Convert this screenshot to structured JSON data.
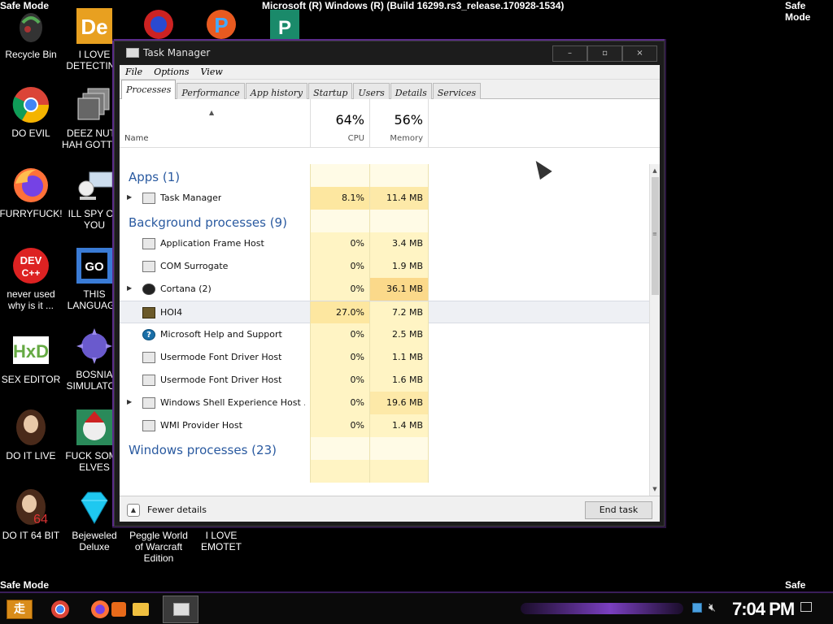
{
  "desktop": {
    "safe_mode_label": "Safe Mode",
    "build_string": "Microsoft (R) Windows (R) (Build 16299.rs3_release.170928-1534)",
    "icons": [
      {
        "label": "Recycle Bin",
        "icon": "recycle-bin-icon"
      },
      {
        "label": "I LOVE DETECTING",
        "icon": "de-app-icon"
      },
      {
        "label": "",
        "icon": "red-blue-app-icon"
      },
      {
        "label": "",
        "icon": "pinball-p-icon"
      },
      {
        "label": "",
        "icon": "publisher-icon"
      },
      {
        "label": "DO EVIL",
        "icon": "chrome-icon"
      },
      {
        "label": "DEEZ NUTS HAH GOTTEM",
        "icon": "copy-windows-icon"
      },
      {
        "label": "FURRYFUCK!",
        "icon": "firefox-icon"
      },
      {
        "label": "ILL SPY ON YOU",
        "icon": "remote-desktop-icon"
      },
      {
        "label": "never used why is it ...",
        "icon": "dev-cpp-icon"
      },
      {
        "label": "THIS LANGUAGE",
        "icon": "goland-icon"
      },
      {
        "label": "SEX EDITOR",
        "icon": "hxd-icon"
      },
      {
        "label": "BOSNIA SIMULATOR",
        "icon": "spiked-ball-icon"
      },
      {
        "label": "DO IT LIVE",
        "icon": "portrait-icon"
      },
      {
        "label": "FUCK SOME ELVES",
        "icon": "santa-game-icon"
      },
      {
        "label": "DO IT 64 BIT",
        "icon": "portrait-64-icon"
      },
      {
        "label": "Bejeweled Deluxe",
        "icon": "bejeweled-gem-icon"
      },
      {
        "label": "Peggle World of Warcraft Edition",
        "icon": ""
      },
      {
        "label": "I LOVE EMOTET",
        "icon": ""
      }
    ]
  },
  "task_manager": {
    "title": "Task Manager",
    "window_controls": [
      "–",
      "▫",
      "×"
    ],
    "menu": [
      "File",
      "Options",
      "View"
    ],
    "tabs": [
      "Processes",
      "Performance",
      "App history",
      "Startup",
      "Users",
      "Details",
      "Services"
    ],
    "active_tab": "Processes",
    "columns": {
      "name": "Name",
      "cpu_percent": "64%",
      "cpu_label": "CPU",
      "memory_percent": "56%",
      "memory_label": "Memory"
    },
    "groups": {
      "apps": "Apps (1)",
      "background": "Background processes (9)",
      "windows": "Windows processes (23)"
    },
    "apps": [
      {
        "name": "Task Manager",
        "cpu": "8.1%",
        "memory": "11.4 MB",
        "expandable": true,
        "icon": "task-manager-icon"
      }
    ],
    "background": [
      {
        "name": "Application Frame Host",
        "cpu": "0%",
        "memory": "3.4 MB",
        "icon": "app-frame-icon"
      },
      {
        "name": "COM Surrogate",
        "cpu": "0%",
        "memory": "1.9 MB",
        "icon": "com-surrogate-icon"
      },
      {
        "name": "Cortana (2)",
        "cpu": "0%",
        "memory": "36.1 MB",
        "expandable": true,
        "icon": "cortana-icon"
      },
      {
        "name": "HOI4",
        "cpu": "27.0%",
        "memory": "7.2 MB",
        "icon": "hoi4-icon"
      },
      {
        "name": "Microsoft Help and Support",
        "cpu": "0%",
        "memory": "2.5 MB",
        "icon": "help-icon"
      },
      {
        "name": "Usermode Font Driver Host",
        "cpu": "0%",
        "memory": "1.1 MB",
        "icon": "font-driver-icon"
      },
      {
        "name": "Usermode Font Driver Host",
        "cpu": "0%",
        "memory": "1.6 MB",
        "icon": "font-driver-icon"
      },
      {
        "name": "Windows Shell Experience Host ...",
        "cpu": "0%",
        "memory": "19.6 MB",
        "expandable": true,
        "icon": "shell-host-icon"
      },
      {
        "name": "WMI Provider Host",
        "cpu": "0%",
        "memory": "1.4 MB",
        "icon": "wmi-icon"
      }
    ],
    "fewer_details": "Fewer details",
    "end_task": "End task"
  },
  "taskbar": {
    "start_glyph": "走",
    "clock": "7:04 PM",
    "pinned": [
      "chrome-icon",
      "firefox-icon",
      "media-player-icon",
      "file-explorer-icon",
      "task-manager-icon"
    ],
    "tray": [
      "network-icon",
      "volume-muted-icon",
      "notifications-icon"
    ]
  }
}
